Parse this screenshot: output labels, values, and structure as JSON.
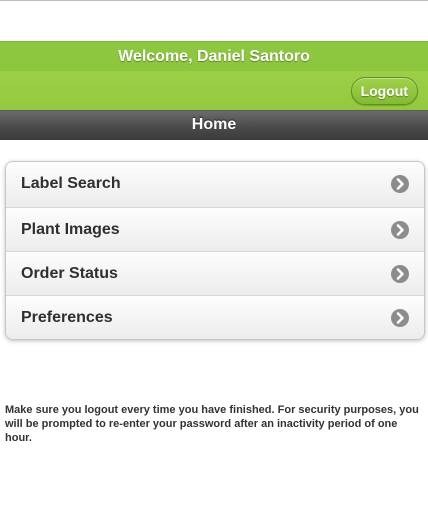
{
  "header": {
    "welcome_text": "Welcome, Daniel Santoro",
    "logout_label": "Logout",
    "page_title": "Home"
  },
  "menu": {
    "items": [
      {
        "label": "Label Search",
        "icon": "chevron-right-icon"
      },
      {
        "label": "Plant Images",
        "icon": "chevron-right-icon"
      },
      {
        "label": "Order Status",
        "icon": "chevron-right-icon"
      },
      {
        "label": "Preferences",
        "icon": "chevron-right-icon"
      }
    ]
  },
  "footer": {
    "notice": "Make sure you logout every time you have finished. For security purposes, you will be prompted to re-enter your password after an inactivity period of one hour."
  },
  "colors": {
    "brand_green": "#8dc63f",
    "title_bar": "#4a4a4a",
    "chevron": "#8c8c8c"
  }
}
